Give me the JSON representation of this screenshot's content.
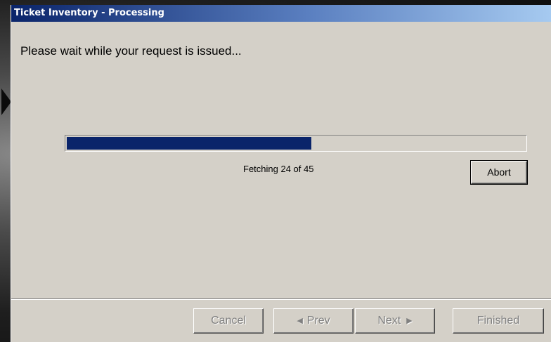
{
  "window": {
    "title": "Ticket Inventory - Processing"
  },
  "message": "Please wait while your request is issued...",
  "progress": {
    "current": 24,
    "total": 45,
    "status_text": "Fetching 24 of 45"
  },
  "buttons": {
    "abort": "Abort",
    "cancel": "Cancel",
    "prev": "Prev",
    "next": "Next",
    "finished": "Finished"
  },
  "icons": {
    "prev": "triangle-left-icon",
    "next": "triangle-right-icon"
  },
  "colors": {
    "titlebar_start": "#0a246a",
    "titlebar_end": "#a6caf0",
    "progress_fill": "#0a246a",
    "dialog_bg": "#d4d0c8",
    "disabled_text": "#808080"
  }
}
